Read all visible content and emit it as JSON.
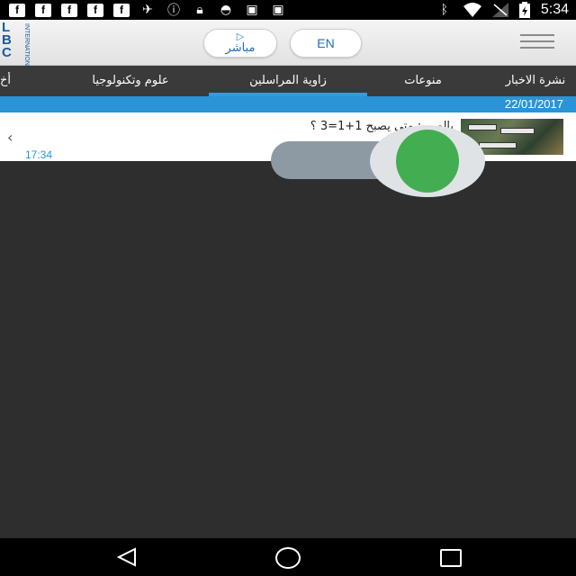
{
  "status_bar": {
    "left_icons": [
      "facebook-icon",
      "facebook-icon",
      "facebook-icon",
      "facebook-icon",
      "facebook-icon",
      "satellite-icon",
      "info-icon",
      "lock-icon",
      "android-icon",
      "briefcase-icon",
      "briefcase-play-icon"
    ],
    "right_icons": [
      "bluetooth-icon",
      "wifi-icon",
      "signal-icon",
      "battery-icon"
    ],
    "time": "5:34"
  },
  "header": {
    "logo_text": "LBC",
    "logo_letters": [
      "L",
      "B",
      "C"
    ],
    "logo_subtext": "INTERNATIONAL",
    "live_label": "مباشر",
    "lang_label": "EN"
  },
  "tabs": {
    "items": [
      {
        "label": "نشرة الاخبار"
      },
      {
        "label": "منوعات"
      },
      {
        "label": "زاوية المراسلين",
        "active": true
      },
      {
        "label": "علوم وتكنولوجيا"
      },
      {
        "label": "أخ"
      }
    ]
  },
  "feed": {
    "date": "22/01/2017",
    "item": {
      "title": "بالصور: متى يصبح 1+1=3 ؟",
      "time": "17:34"
    }
  },
  "toggle": {
    "state": "on"
  },
  "colors": {
    "accent": "#2a94d6",
    "toggle_on": "#43ad52",
    "tab_bar": "#3a3a3a",
    "background": "#2e2e2e"
  }
}
